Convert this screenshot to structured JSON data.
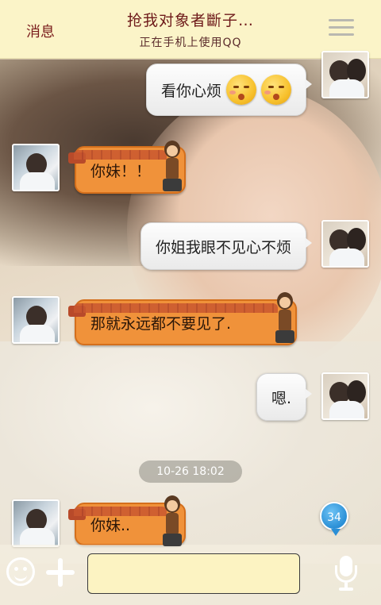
{
  "header": {
    "back_label": "消息",
    "title": "抢我对象者斷子…",
    "subtitle": "正在手机上使用QQ",
    "menu_icon": "menu-icon"
  },
  "messages": [
    {
      "side": "right",
      "text": "看你心烦",
      "emoji_count": 2
    },
    {
      "side": "left",
      "text": "你妹！！"
    },
    {
      "side": "right",
      "text": "你姐我眼不见心不烦"
    },
    {
      "side": "left",
      "text": "那就永远都不要见了."
    },
    {
      "side": "right",
      "text": "嗯."
    },
    {
      "side": "left",
      "text": "你妹.."
    }
  ],
  "timestamp": "10-26 18:02",
  "unread_badge": "34",
  "input": {
    "value": "",
    "placeholder": ""
  },
  "colors": {
    "header_bg": "#fbf4c8",
    "left_bubble": "#f0923a",
    "right_bubble": "#f3f3f3",
    "badge": "#2a8fd6"
  }
}
